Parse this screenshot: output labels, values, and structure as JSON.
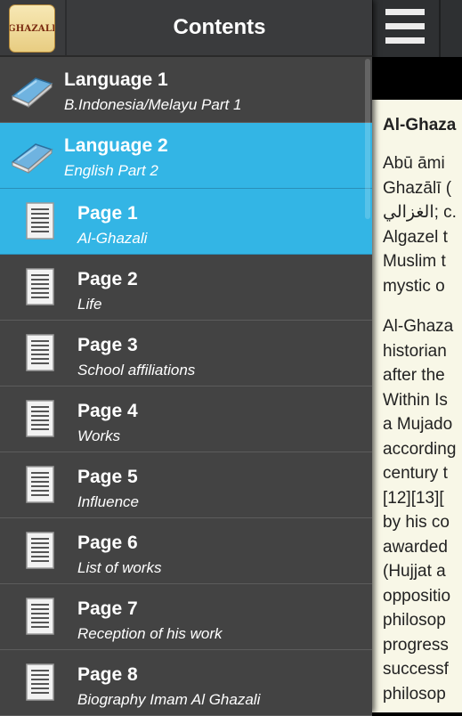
{
  "drawer": {
    "title": "Contents",
    "logo_text": "GHAZALI",
    "items": [
      {
        "type": "language",
        "title": "Language 1",
        "subtitle": "B.Indonesia/Melayu Part 1",
        "selected": false,
        "icon": "book-icon"
      },
      {
        "type": "language",
        "title": "Language 2",
        "subtitle": "English Part 2",
        "selected": true,
        "icon": "book-icon"
      },
      {
        "type": "page",
        "title": "Page 1",
        "subtitle": "Al-Ghazali",
        "selected": true,
        "icon": "document-icon"
      },
      {
        "type": "page",
        "title": "Page 2",
        "subtitle": "Life",
        "selected": false,
        "icon": "document-icon"
      },
      {
        "type": "page",
        "title": "Page 3",
        "subtitle": "School affiliations",
        "selected": false,
        "icon": "document-icon"
      },
      {
        "type": "page",
        "title": "Page 4",
        "subtitle": "Works",
        "selected": false,
        "icon": "document-icon"
      },
      {
        "type": "page",
        "title": "Page 5",
        "subtitle": "Influence",
        "selected": false,
        "icon": "document-icon"
      },
      {
        "type": "page",
        "title": "Page 6",
        "subtitle": "List of works",
        "selected": false,
        "icon": "document-icon"
      },
      {
        "type": "page",
        "title": "Page 7",
        "subtitle": "Reception of his work",
        "selected": false,
        "icon": "document-icon"
      },
      {
        "type": "page",
        "title": "Page 8",
        "subtitle": "Biography Imam Al Ghazali",
        "selected": false,
        "icon": "document-icon"
      }
    ]
  },
  "content": {
    "menu_icon": "hamburger-menu-icon",
    "article_title": "Al-Ghaza",
    "paragraph1_lines": [
      "Abū  āmi",
      "Ghazālī (",
      "الغزالي; c.",
      "Algazel t",
      "Muslim t",
      "mystic o"
    ],
    "paragraph2_lines": [
      "Al-Ghaza",
      "historian",
      "after the",
      "Within Is",
      "a Mujado",
      "according",
      "century t",
      "[12][13][",
      "by his co",
      "awarded",
      "(Hujjat a",
      "oppositio",
      "philosop",
      "progress",
      "successf",
      "philosop"
    ]
  },
  "colors": {
    "accent": "#33b5e5",
    "drawer_bg": "#434343",
    "topbar_bg": "#3a3b3d",
    "content_bg": "#f8f7e7"
  }
}
